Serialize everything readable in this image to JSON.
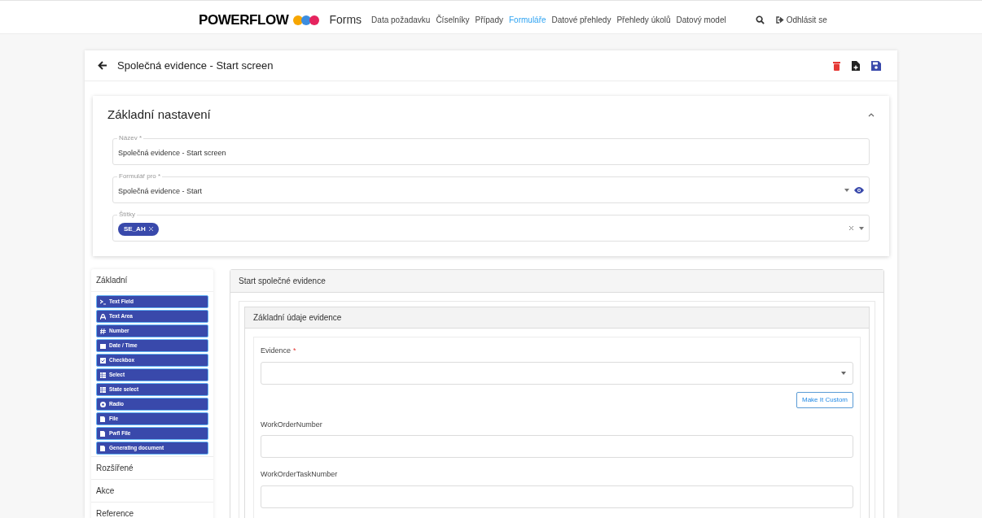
{
  "navbar": {
    "logo": "POWERFLOW",
    "app": "Forms",
    "links": [
      {
        "label": "Data požadavku",
        "selected": false
      },
      {
        "label": "Číselníky",
        "selected": false
      },
      {
        "label": "Případy",
        "selected": false
      },
      {
        "label": "Formuláře",
        "selected": true
      },
      {
        "label": "Datové přehledy",
        "selected": false
      },
      {
        "label": "Přehledy úkolů",
        "selected": false
      },
      {
        "label": "Datový model",
        "selected": false
      }
    ],
    "logout": "Odhlásit se"
  },
  "page": {
    "title": "Společná evidence - Start screen"
  },
  "settings": {
    "title": "Základní nastavení",
    "expanded": true,
    "fields": [
      {
        "kind": "text",
        "label": "Název *",
        "value": "Společná evidence - Start screen"
      },
      {
        "kind": "select",
        "label": "Formulář pro *",
        "value": "Společná evidence - Start"
      },
      {
        "kind": "tags",
        "label": "Štítky",
        "tags": [
          "SE_AH"
        ]
      }
    ]
  },
  "sidebar": {
    "groups": [
      {
        "title": "Základní",
        "expanded": true,
        "components": [
          {
            "label": "Text Field"
          },
          {
            "label": "Text Area"
          },
          {
            "label": "Number"
          },
          {
            "label": "Date / Time"
          },
          {
            "label": "Checkbox"
          },
          {
            "label": "Select"
          },
          {
            "label": "State select"
          },
          {
            "label": "Radio"
          },
          {
            "label": "File"
          },
          {
            "label": "Pwfl File"
          },
          {
            "label": "Generating document"
          }
        ]
      },
      {
        "title": "Rozšířené",
        "expanded": false
      },
      {
        "title": "Akce",
        "expanded": false
      },
      {
        "title": "Reference",
        "expanded": false
      }
    ]
  },
  "builder": {
    "panel_title": "Start společné evidence",
    "section_title": "Základní údaje evidence",
    "fields": [
      {
        "kind": "select",
        "label": "Evidence",
        "required_mark": "*",
        "button": "Make It Custom"
      },
      {
        "kind": "text",
        "label": "WorkOrderNumber"
      },
      {
        "kind": "text",
        "label": "WorkOrderTaskNumber"
      }
    ]
  }
}
